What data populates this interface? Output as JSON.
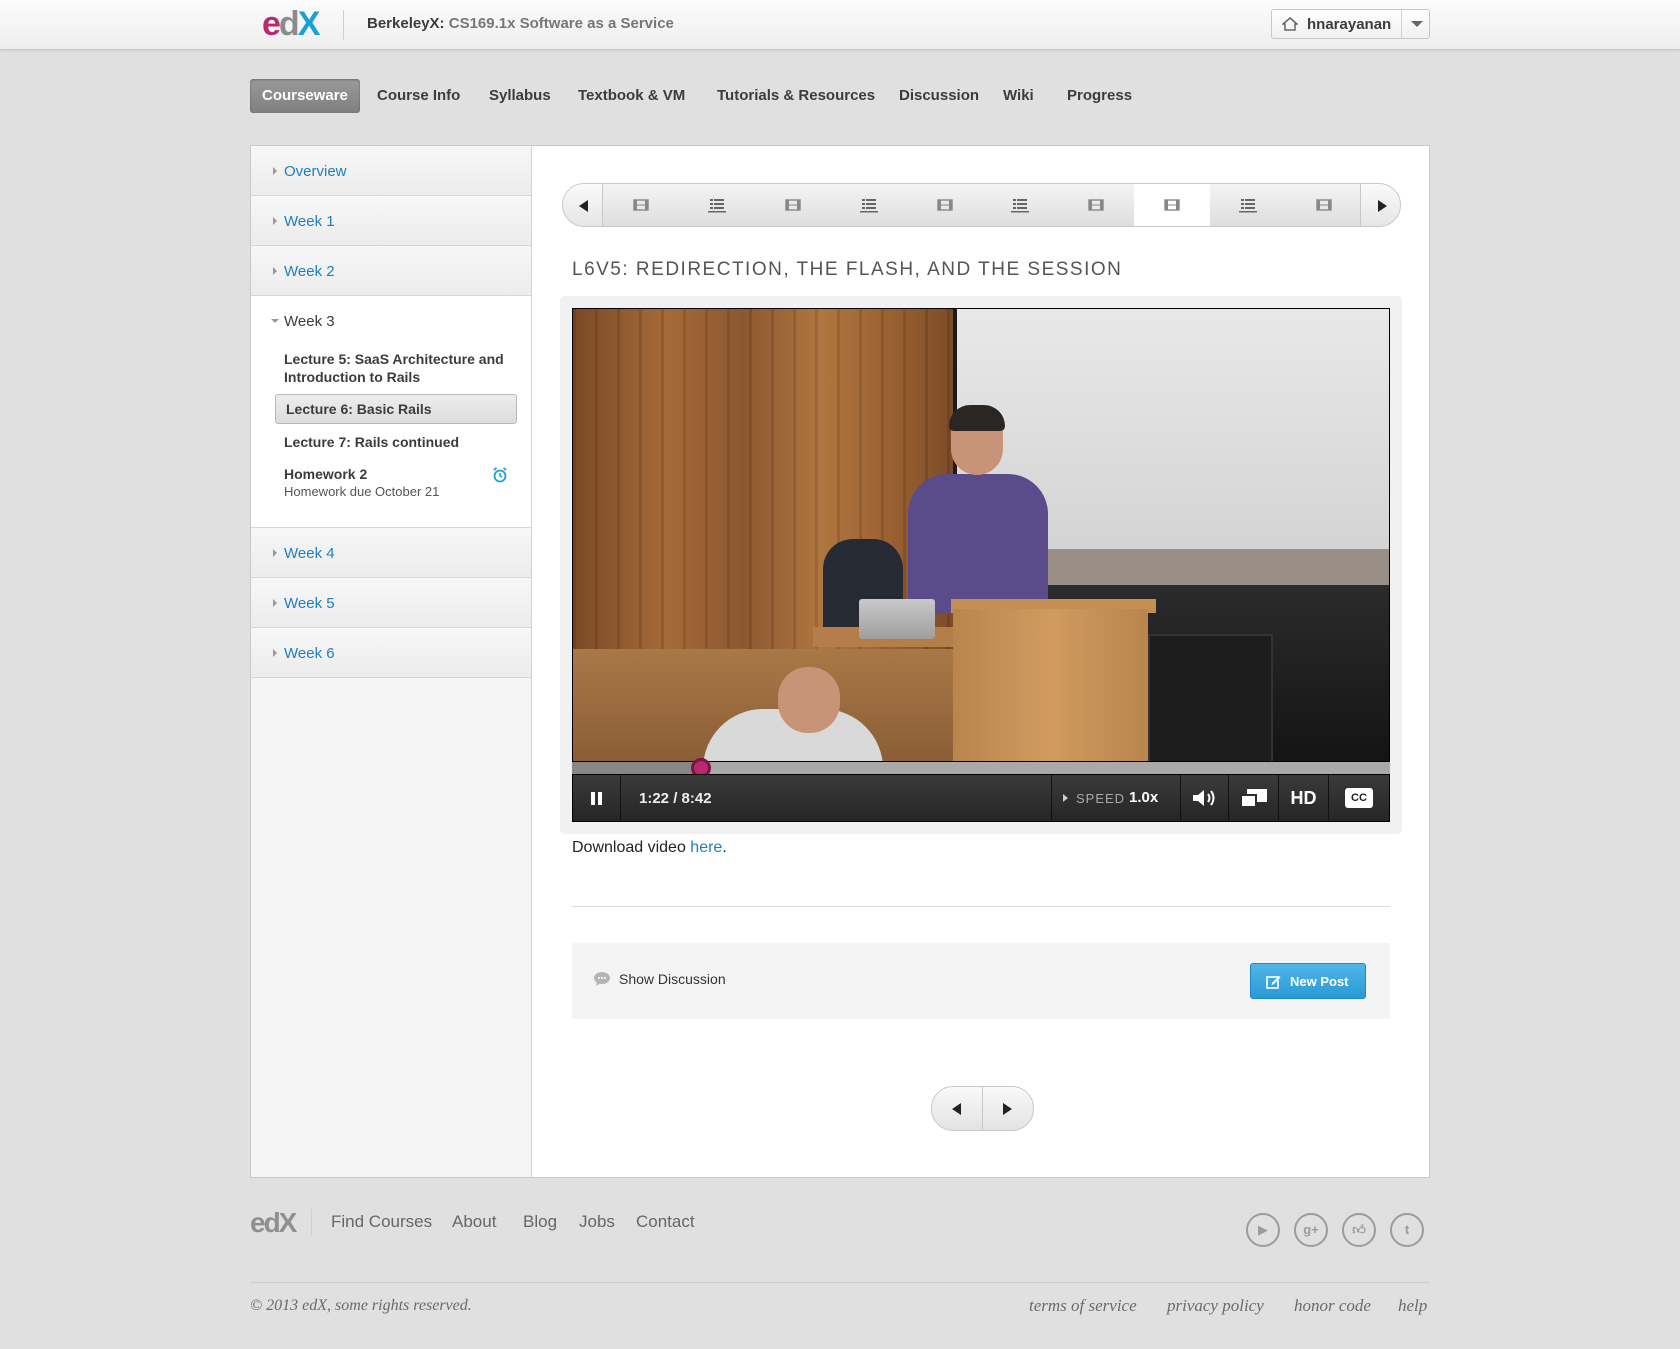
{
  "header": {
    "logo": "edX",
    "course_org": "BerkeleyX:",
    "course_name": "CS169.1x Software as a Service",
    "username": "hnarayanan"
  },
  "tabs": [
    {
      "label": "Courseware",
      "active": true
    },
    {
      "label": "Course Info"
    },
    {
      "label": "Syllabus"
    },
    {
      "label": "Textbook & VM"
    },
    {
      "label": "Tutorials & Resources"
    },
    {
      "label": "Discussion"
    },
    {
      "label": "Wiki"
    },
    {
      "label": "Progress"
    }
  ],
  "sidebar": {
    "chapters": [
      {
        "label": "Overview"
      },
      {
        "label": "Week 1"
      },
      {
        "label": "Week 2"
      },
      {
        "label": "Week 3",
        "open": true
      },
      {
        "label": "Week 4"
      },
      {
        "label": "Week 5"
      },
      {
        "label": "Week 6"
      }
    ],
    "week3_sections": [
      {
        "label": "Lecture 5: SaaS Architecture and Introduction to Rails"
      },
      {
        "label": "Lecture 6: Basic Rails",
        "active": true
      },
      {
        "label": "Lecture 7: Rails continued"
      },
      {
        "label": "Homework 2",
        "sub": "Homework due October 21"
      }
    ]
  },
  "sequence": {
    "items": [
      "video-icon",
      "list-icon",
      "video-icon",
      "list-icon",
      "video-icon",
      "list-icon",
      "video-icon",
      "video-icon",
      "list-icon",
      "video-icon"
    ],
    "active_index": 7
  },
  "unit": {
    "title": "L6V5: REDIRECTION, THE FLASH, AND THE SESSION"
  },
  "video": {
    "time": "1:22 / 8:42",
    "progress_fraction": 0.158,
    "speed_label": "SPEED",
    "speed_value": "1.0x",
    "hd_label": "HD",
    "cc_label": "CC"
  },
  "download": {
    "prefix": "Download video ",
    "link": "here",
    "suffix": "."
  },
  "discussion": {
    "show_label": "Show Discussion",
    "new_post_label": "New Post"
  },
  "footer": {
    "logo": "edX",
    "nav": [
      "Find Courses",
      "About",
      "Blog",
      "Jobs",
      "Contact"
    ],
    "social": [
      "youtube-icon",
      "google-plus-icon",
      "facebook-like-icon",
      "twitter-icon"
    ],
    "copyright": "© 2013 edX, some rights reserved.",
    "legal": [
      "terms of service",
      "privacy policy",
      "honor code",
      "help"
    ]
  },
  "colors": {
    "accent": "#1d7fbf",
    "brand_magenta": "#b9296e",
    "brand_blue": "#1a9fd8",
    "button_blue": "#2a9ad6"
  }
}
